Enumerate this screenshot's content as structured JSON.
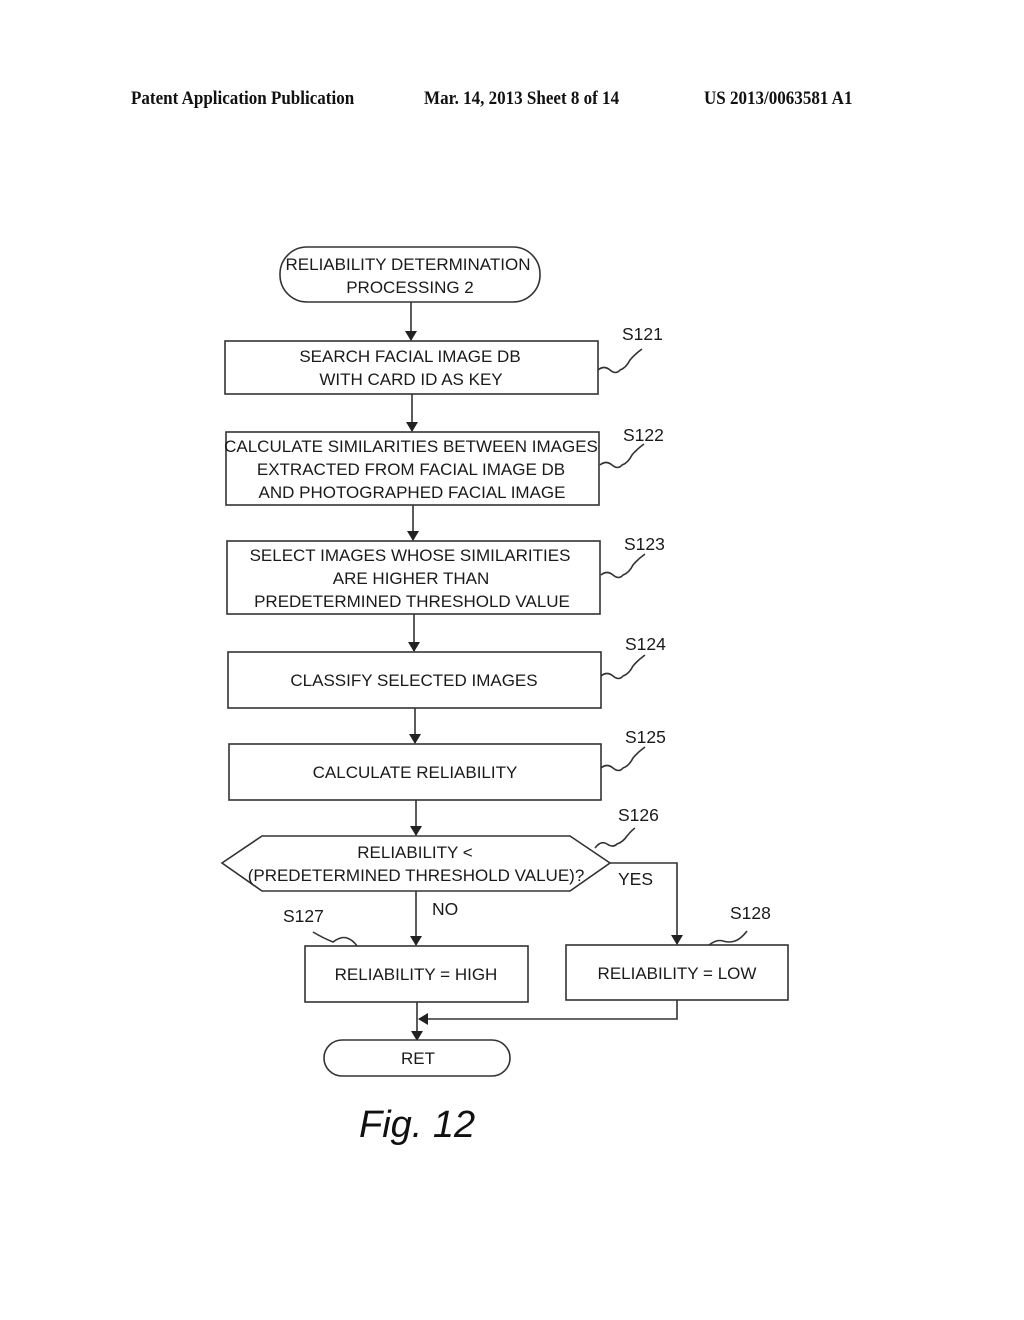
{
  "header": {
    "left": "Patent Application Publication",
    "middle": "Mar. 14, 2013  Sheet 8 of 14",
    "right": "US 2013/0063581 A1"
  },
  "flowchart": {
    "start": {
      "lines": [
        "RELIABILITY DETERMINATION",
        "PROCESSING 2"
      ]
    },
    "steps": [
      {
        "id": "S121",
        "lines": [
          "SEARCH FACIAL IMAGE DB",
          "WITH CARD ID AS KEY"
        ]
      },
      {
        "id": "S122",
        "lines": [
          "CALCULATE SIMILARITIES BETWEEN IMAGES",
          "EXTRACTED FROM FACIAL IMAGE DB",
          "AND PHOTOGRAPHED FACIAL IMAGE"
        ]
      },
      {
        "id": "S123",
        "lines": [
          "SELECT IMAGES WHOSE SIMILARITIES",
          "ARE HIGHER THAN",
          "PREDETERMINED THRESHOLD VALUE"
        ]
      },
      {
        "id": "S124",
        "lines": [
          "CLASSIFY SELECTED IMAGES"
        ]
      },
      {
        "id": "S125",
        "lines": [
          "CALCULATE RELIABILITY"
        ]
      }
    ],
    "decision": {
      "id": "S126",
      "lines": [
        "RELIABILITY <",
        "(PREDETERMINED THRESHOLD VALUE)?"
      ],
      "yes_label": "YES",
      "no_label": "NO"
    },
    "branch_no": {
      "id": "S127",
      "lines": [
        "RELIABILITY = HIGH"
      ]
    },
    "branch_yes": {
      "id": "S128",
      "lines": [
        "RELIABILITY = LOW"
      ]
    },
    "end": {
      "lines": [
        "RET"
      ]
    }
  },
  "figure_label": "Fig. 12"
}
